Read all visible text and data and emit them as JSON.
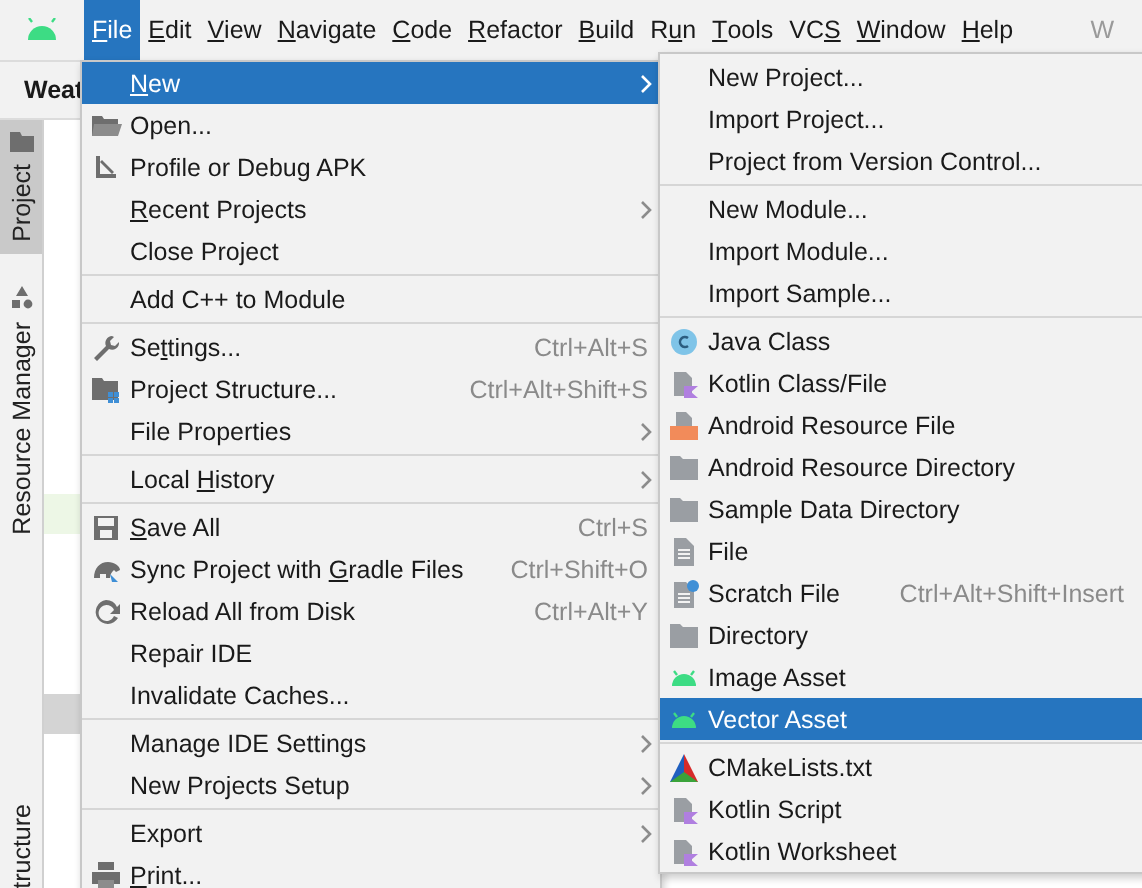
{
  "menubar": [
    {
      "key": "F",
      "label": "ile",
      "selected": true
    },
    {
      "key": "E",
      "label": "dit",
      "selected": false
    },
    {
      "key": "V",
      "label": "iew",
      "selected": false
    },
    {
      "key": "N",
      "label": "avigate",
      "selected": false
    },
    {
      "key": "C",
      "label": "ode",
      "selected": false
    },
    {
      "key": "R",
      "label": "efactor",
      "selected": false
    },
    {
      "key": "B",
      "label": "uild",
      "selected": false
    },
    {
      "before": "R",
      "key": "u",
      "label": "n",
      "selected": false
    },
    {
      "key": "T",
      "label": "ools",
      "selected": false
    },
    {
      "before": "VC",
      "key": "S",
      "selected": false
    },
    {
      "key": "W",
      "label": "indow",
      "selected": false
    },
    {
      "key": "H",
      "label": "elp",
      "selected": false
    }
  ],
  "title_fragment": "W",
  "toolbar": {
    "project_name": "Weat"
  },
  "tool_strip": [
    {
      "label": "Project",
      "selected": true
    },
    {
      "label": "Resource Manager",
      "selected": false
    },
    {
      "label": "tructure",
      "selected": false
    }
  ],
  "file_menu": {
    "groups": [
      [
        {
          "key": "N",
          "label": "ew",
          "submenu": true,
          "selected": true
        },
        {
          "label": "Open...",
          "submenu": false,
          "selected": false
        },
        {
          "label": "Profile or Debug APK",
          "submenu": false,
          "selected": false
        },
        {
          "key": "R",
          "label": "ecent Projects",
          "submenu": true,
          "selected": false
        },
        {
          "label": "Close Project",
          "submenu": false,
          "selected": false
        }
      ],
      [
        {
          "label": "Add C++ to Module",
          "submenu": false,
          "selected": false
        }
      ],
      [
        {
          "before": "Se",
          "key": "t",
          "label": "tings...",
          "shortcut": "Ctrl+Alt+S",
          "submenu": false,
          "selected": false
        },
        {
          "label": "Project Structure...",
          "shortcut": "Ctrl+Alt+Shift+S",
          "submenu": false,
          "selected": false
        },
        {
          "label": "File Properties",
          "submenu": true,
          "selected": false
        }
      ],
      [
        {
          "before": "Local ",
          "key": "H",
          "label": "istory",
          "submenu": true,
          "selected": false
        }
      ],
      [
        {
          "key": "S",
          "label": "ave All",
          "shortcut": "Ctrl+S",
          "submenu": false,
          "selected": false
        },
        {
          "before": "Sync Project with ",
          "key": "G",
          "label": "radle Files",
          "shortcut": "Ctrl+Shift+O",
          "submenu": false,
          "selected": false
        },
        {
          "label": "Reload All from Disk",
          "shortcut": "Ctrl+Alt+Y",
          "submenu": false,
          "selected": false
        },
        {
          "label": "Repair IDE",
          "submenu": false,
          "selected": false
        },
        {
          "label": "Invalidate Caches...",
          "submenu": false,
          "selected": false
        }
      ],
      [
        {
          "label": "Manage IDE Settings",
          "submenu": true,
          "selected": false
        },
        {
          "label": "New Projects Setup",
          "submenu": true,
          "selected": false
        }
      ],
      [
        {
          "label": "Export",
          "submenu": true,
          "selected": false
        },
        {
          "key": "P",
          "label": "rint...",
          "submenu": false,
          "selected": false
        }
      ]
    ]
  },
  "new_submenu": {
    "groups": [
      [
        {
          "label": "New Project...",
          "selected": false
        },
        {
          "label": "Import Project...",
          "selected": false
        },
        {
          "label": "Project from Version Control...",
          "selected": false
        }
      ],
      [
        {
          "label": "New Module...",
          "selected": false
        },
        {
          "label": "Import Module...",
          "selected": false
        },
        {
          "label": "Import Sample...",
          "selected": false
        }
      ],
      [
        {
          "label": "Java Class",
          "selected": false
        },
        {
          "label": "Kotlin Class/File",
          "selected": false
        },
        {
          "label": "Android Resource File",
          "selected": false
        },
        {
          "label": "Android Resource Directory",
          "selected": false
        },
        {
          "label": "Sample Data Directory",
          "selected": false
        },
        {
          "label": "File",
          "selected": false
        },
        {
          "label": "Scratch File",
          "shortcut": "Ctrl+Alt+Shift+Insert",
          "selected": false
        },
        {
          "label": "Directory",
          "selected": false
        },
        {
          "label": "Image Asset",
          "selected": false
        },
        {
          "label": "Vector Asset",
          "selected": true
        }
      ],
      [
        {
          "label": "CMakeLists.txt",
          "selected": false
        },
        {
          "label": "Kotlin Script",
          "selected": false
        },
        {
          "label": "Kotlin Worksheet",
          "selected": false
        }
      ]
    ]
  }
}
